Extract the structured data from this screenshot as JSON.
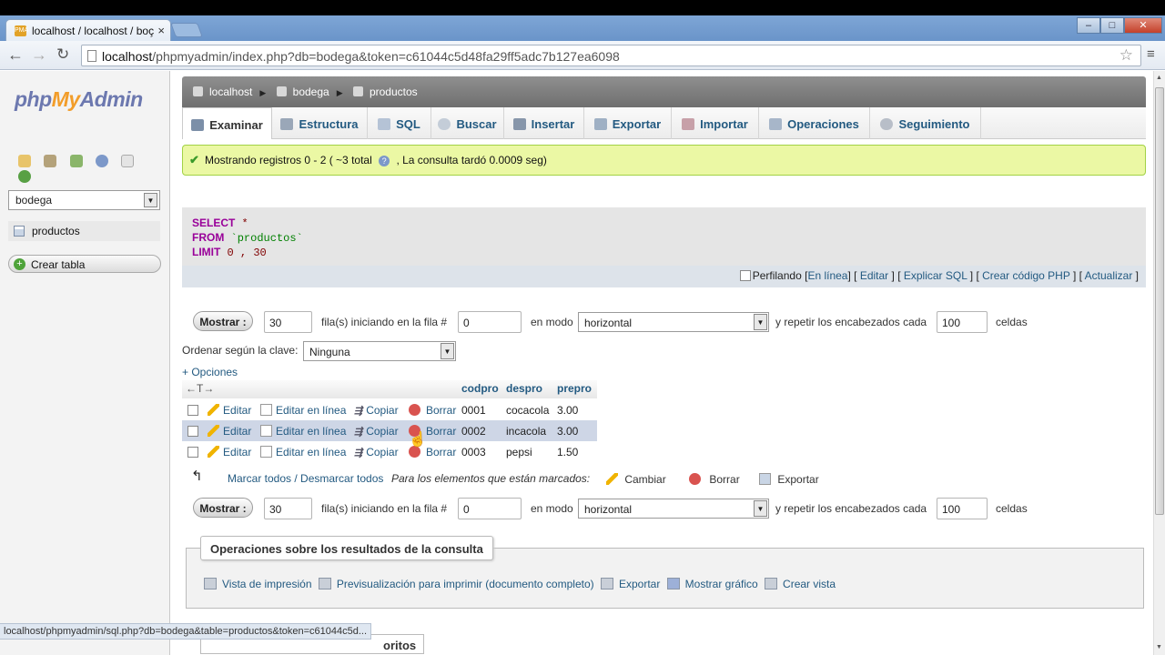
{
  "browser": {
    "tab_title": "localhost / localhost / boç",
    "url_host": "localhost",
    "url_path": "/phpmyadmin/index.php?db=bodega&token=c61044c5d48fa29ff5adc7b127ea6098",
    "status_url": "localhost/phpmyadmin/sql.php?db=bodega&table=productos&token=c61044c5d..."
  },
  "sidebar": {
    "logo_php": "php",
    "logo_my": "My",
    "logo_admin": "Admin",
    "db_selected": "bodega",
    "table_item": "productos",
    "create_table": "Crear tabla"
  },
  "breadcrumb": {
    "server": "localhost",
    "database": "bodega",
    "table": "productos"
  },
  "tabs": [
    {
      "label": "Examinar",
      "icon": "browse-icon"
    },
    {
      "label": "Estructura",
      "icon": "structure-icon"
    },
    {
      "label": "SQL",
      "icon": "sql-icon"
    },
    {
      "label": "Buscar",
      "icon": "search-icon"
    },
    {
      "label": "Insertar",
      "icon": "insert-icon"
    },
    {
      "label": "Exportar",
      "icon": "export-icon"
    },
    {
      "label": "Importar",
      "icon": "import-icon"
    },
    {
      "label": "Operaciones",
      "icon": "wrench-icon"
    },
    {
      "label": "Seguimiento",
      "icon": "eye-icon"
    }
  ],
  "success": {
    "text_before": "Mostrando registros 0 - 2 ( ~3 total",
    "text_after": ", La consulta tardó 0.0009 seg)"
  },
  "sql": {
    "select": "SELECT",
    "star": "*",
    "from": "FROM",
    "table": "`productos`",
    "limit": "LIMIT",
    "limit_vals": "0 , 30",
    "profiling": "Perfilando",
    "links": [
      "En línea",
      "Editar",
      "Explicar SQL",
      "Crear código PHP",
      "Actualizar"
    ]
  },
  "nav": {
    "show_button": "Mostrar :",
    "rows": "30",
    "rows_label": "fila(s) iniciando en la fila #",
    "start": "0",
    "mode_label": "en modo",
    "mode": "horizontal",
    "repeat_label": "y repetir los encabezados cada",
    "repeat": "100",
    "cells_label": "celdas"
  },
  "sort": {
    "label": "Ordenar según la clave:",
    "value": "Ninguna"
  },
  "options_link": "+ Opciones",
  "table": {
    "arrows": "←T→",
    "columns": [
      "codpro",
      "despro",
      "prepro"
    ],
    "actions": {
      "edit": "Editar",
      "inline": "Editar en línea",
      "copy": "Copiar",
      "delete": "Borrar"
    },
    "rows": [
      [
        "0001",
        "cocacola",
        "3.00"
      ],
      [
        "0002",
        "incacola",
        "3.00"
      ],
      [
        "0003",
        "pepsi",
        "1.50"
      ]
    ]
  },
  "bulk": {
    "mark": "Marcar todos / Desmarcar todos",
    "for_marked": "Para los elementos que están marcados:",
    "change": "Cambiar",
    "delete": "Borrar",
    "export": "Exportar"
  },
  "query_ops": {
    "legend": "Operaciones sobre los resultados de la consulta",
    "print": "Vista de impresión",
    "print_full": "Previsualización para imprimir (documento completo)",
    "export": "Exportar",
    "chart": "Mostrar gráfico",
    "view": "Crear vista"
  },
  "favorites_partial": "oritos"
}
